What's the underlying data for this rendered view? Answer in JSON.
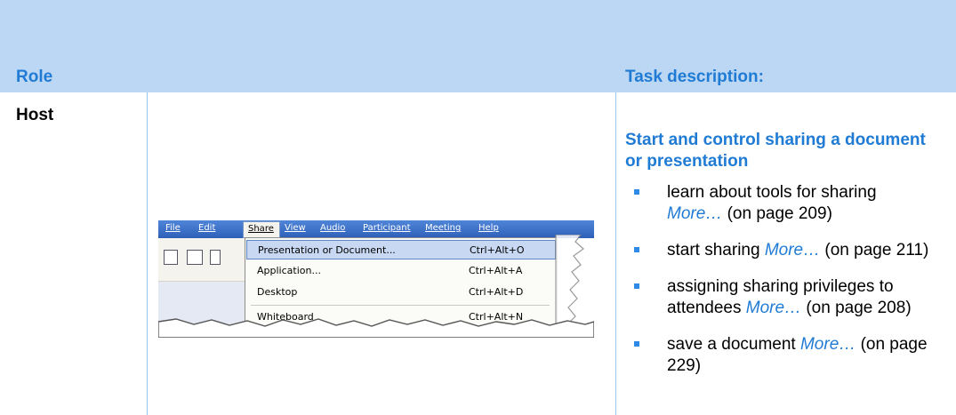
{
  "table": {
    "headers": {
      "role": "Role",
      "task": "Task description:"
    },
    "row": {
      "role": "Host",
      "task_title": "Start and control sharing a document or presentation",
      "tasks": [
        {
          "text": "learn about tools for sharing",
          "more": "More…",
          "ref": "(on page 209)"
        },
        {
          "text": "start sharing",
          "more": "More…",
          "ref": "(on page 211)"
        },
        {
          "text": "assigning sharing privileges to attendees",
          "more": "More…",
          "ref": "(on page 208)"
        },
        {
          "text": "save a document",
          "more": "More…",
          "ref": "(on page 229)"
        }
      ]
    }
  },
  "screenshot": {
    "menubar": [
      "File",
      "Edit",
      "Share",
      "View",
      "Audio",
      "Participant",
      "Meeting",
      "Help"
    ],
    "share_menu": [
      {
        "label": "Presentation or Document...",
        "shortcut": "Ctrl+Alt+O",
        "highlighted": true
      },
      {
        "label": "Application...",
        "shortcut": "Ctrl+Alt+A"
      },
      {
        "label": "Desktop",
        "shortcut": "Ctrl+Alt+D"
      },
      {
        "label": "Whiteboard",
        "shortcut": "Ctrl+Alt+N"
      }
    ]
  },
  "colors": {
    "header_band": "#bcd7f3",
    "heading_blue": "#1f7bd4",
    "bullet": "#2e8ae6"
  }
}
